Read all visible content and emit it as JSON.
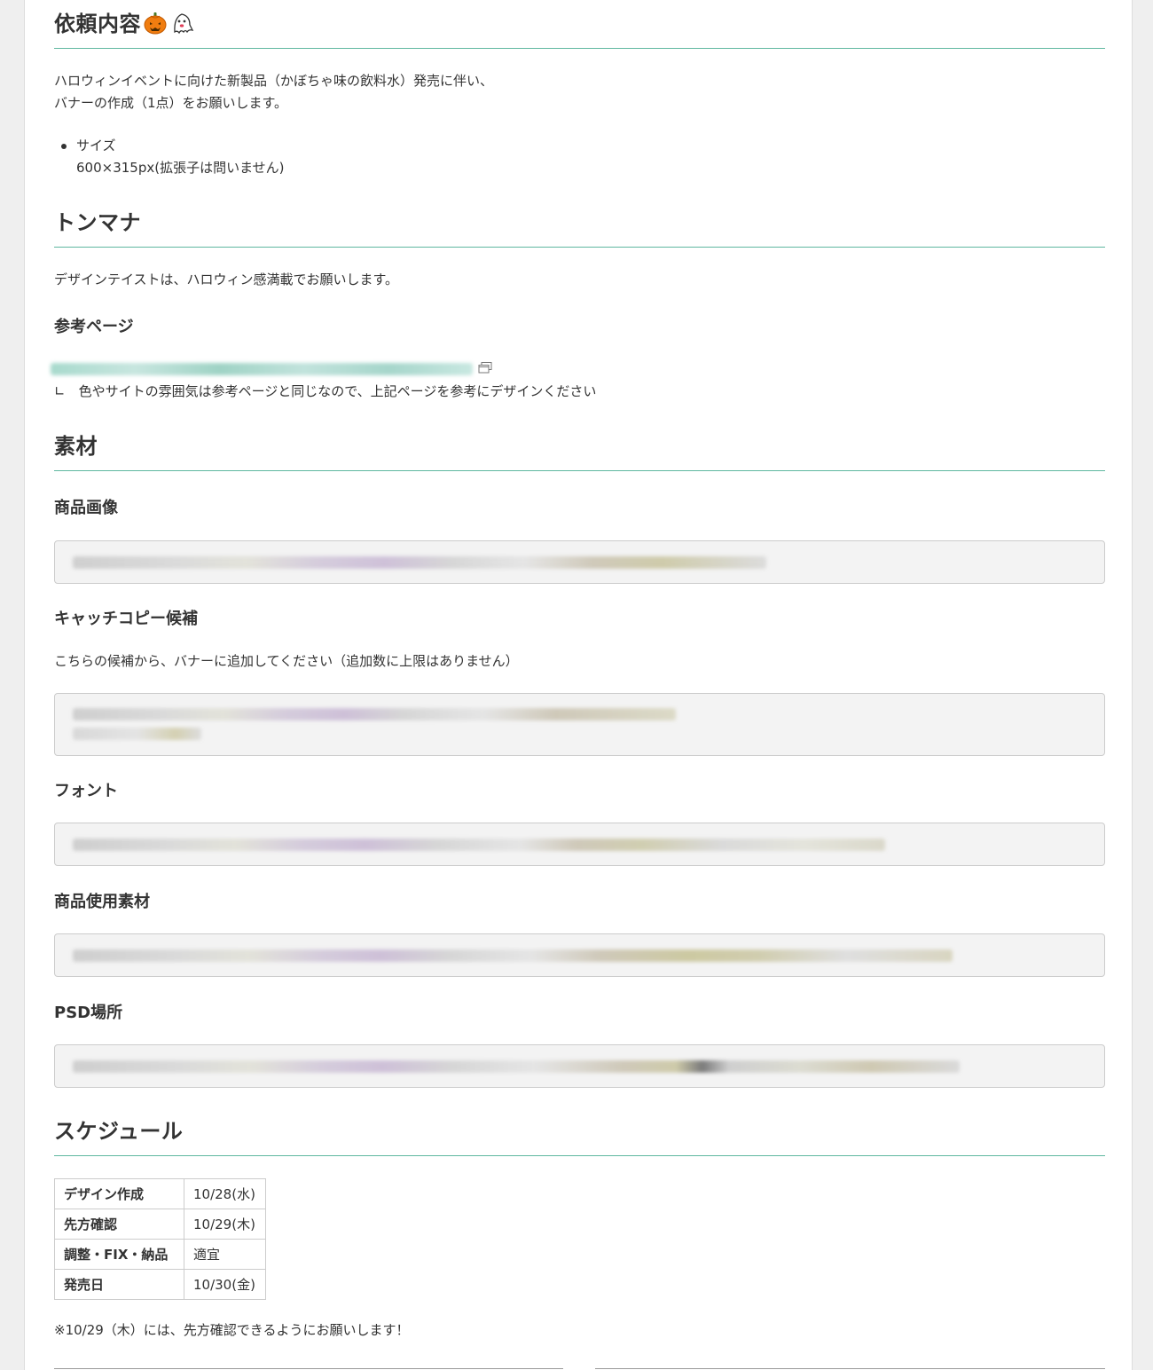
{
  "sections": {
    "request": {
      "heading": "依頼内容",
      "body_line1": "ハロウィンイベントに向けた新製品（かぼちゃ味の飲料水）発売に伴い、",
      "body_line2": "バナーの作成（1点）をお願いします。",
      "bullet_label": "サイズ",
      "bullet_value": "600×315px(拡張子は問いません)",
      "emoji": [
        "pumpkin-icon",
        "ghost-icon"
      ]
    },
    "tone": {
      "heading": "トンマナ",
      "body": "デザインテイストは、ハロウィン感満載でお願いします。",
      "ref_heading": "参考ページ",
      "ref_note": "∟　色やサイトの雰囲気は参考ページと同じなので、上記ページを参考にデザインください"
    },
    "materials": {
      "heading": "素材",
      "product_image": "商品画像",
      "catch_copy": "キャッチコピー候補",
      "catch_copy_note": "こちらの候補から、バナーに追加してください（追加数に上限はありません）",
      "font": "フォント",
      "product_material": "商品使用素材",
      "psd_location": "PSD場所"
    },
    "schedule": {
      "heading": "スケジュール",
      "rows": [
        {
          "label": "デザイン作成",
          "value": "10/28(水)"
        },
        {
          "label": "先方確認",
          "value": "10/29(木)"
        },
        {
          "label": "調整・FIX・納品",
          "value": "適宜"
        },
        {
          "label": "発売日",
          "value": "10/30(金)"
        }
      ],
      "note": "※10/29（木）には、先方確認できるようにお願いします！"
    }
  },
  "colors": {
    "heading_rule": "#5fb7a0",
    "link": "#3aa58c",
    "codebox_bg": "#f3f3f3"
  }
}
